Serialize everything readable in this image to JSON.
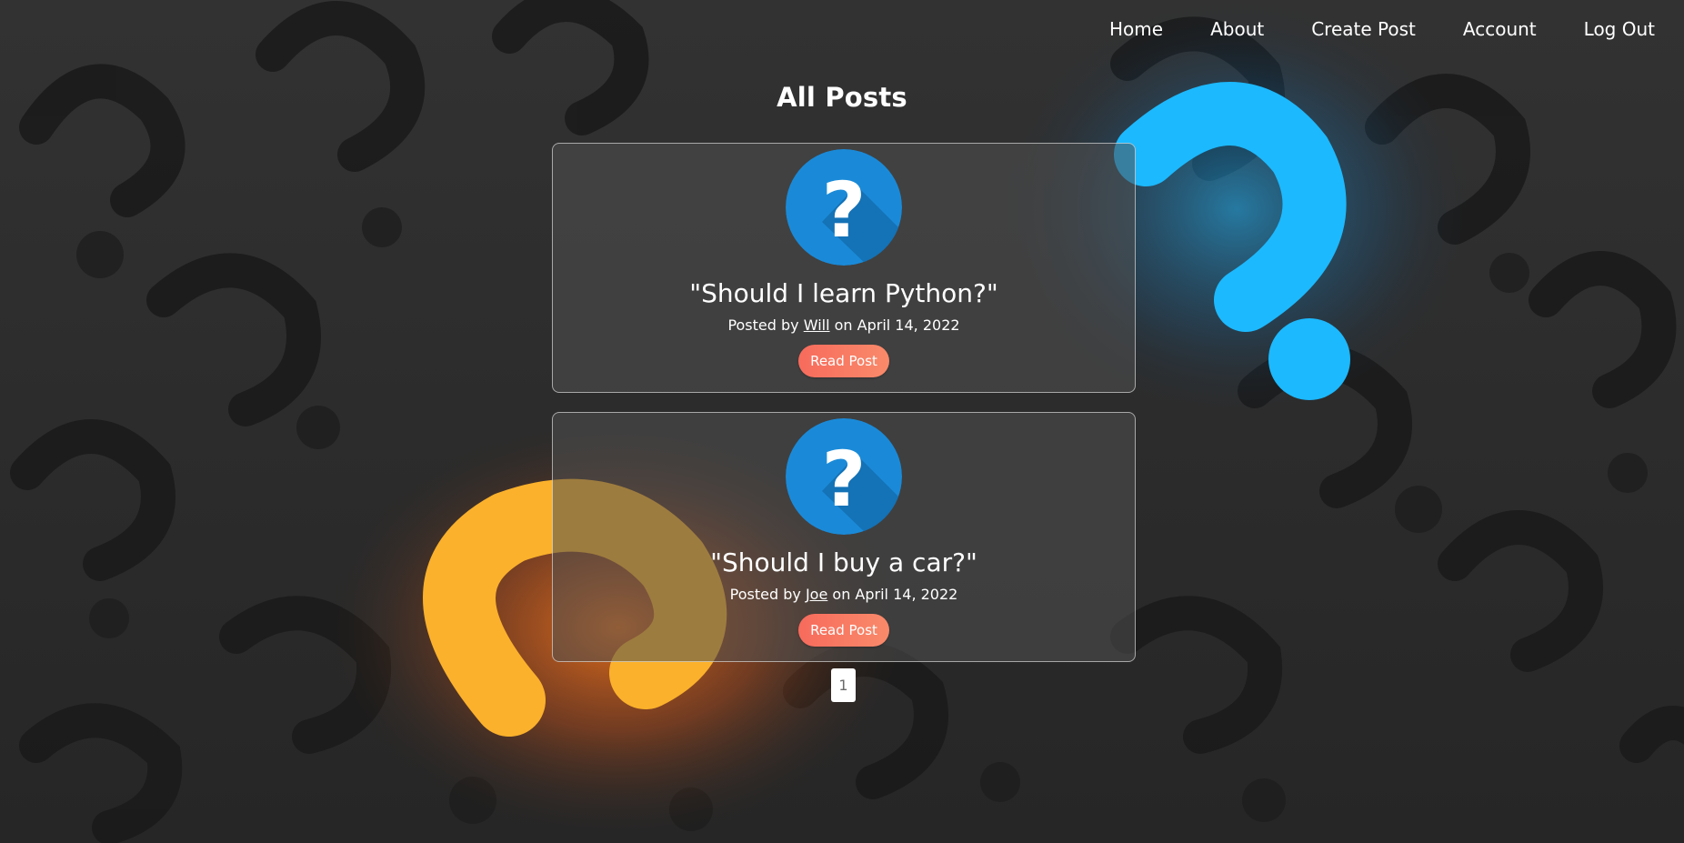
{
  "nav": {
    "items": [
      {
        "label": "Home"
      },
      {
        "label": "About"
      },
      {
        "label": "Create Post"
      },
      {
        "label": "Account"
      },
      {
        "label": "Log Out"
      }
    ]
  },
  "page": {
    "heading": "All Posts"
  },
  "posts": [
    {
      "title": "\"Should I learn Python?\"",
      "posted_by_prefix": "Posted by",
      "author": "Will",
      "date_text": "on April 14, 2022",
      "button_label": "Read Post"
    },
    {
      "title": "\"Should I buy a car?\"",
      "posted_by_prefix": "Posted by",
      "author": "Joe",
      "date_text": "on April 14, 2022",
      "button_label": "Read Post"
    }
  ],
  "pagination": {
    "current_page": "1"
  },
  "colors": {
    "avatar_blue": "#1a8ad8",
    "button_start": "#f76b5c",
    "button_end": "#f98a6a",
    "card_border": "#c8c8c8"
  },
  "icons": {
    "post_avatar": "question-mark-circle-icon",
    "background": "question-marks-background"
  }
}
